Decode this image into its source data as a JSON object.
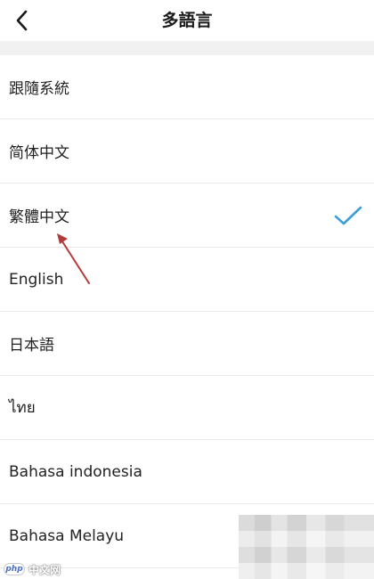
{
  "header": {
    "title": "多語言",
    "back_icon": "chevron-left-icon"
  },
  "languages": [
    {
      "label": "跟隨系統",
      "selected": false
    },
    {
      "label": "简体中文",
      "selected": false
    },
    {
      "label": "繁體中文",
      "selected": true
    },
    {
      "label": "English",
      "selected": false
    },
    {
      "label": "日本語",
      "selected": false
    },
    {
      "label": "ไทย",
      "selected": false
    },
    {
      "label": "Bahasa indonesia",
      "selected": false
    },
    {
      "label": "Bahasa Melayu",
      "selected": false
    }
  ],
  "colors": {
    "check": "#3a9fd9",
    "arrow": "#b23a3a",
    "band": "#f1f1f1"
  },
  "watermark": {
    "logo": "php",
    "text": "中文网"
  }
}
